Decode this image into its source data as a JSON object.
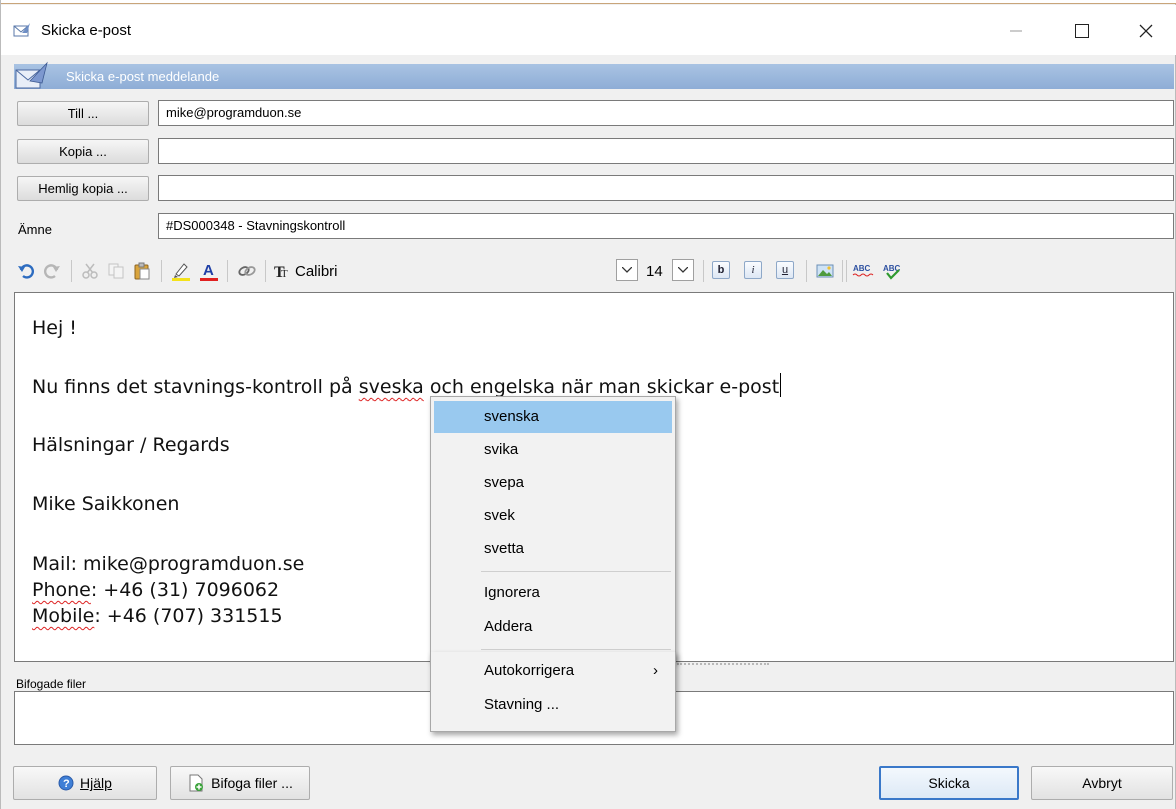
{
  "window": {
    "title": "Skicka e-post"
  },
  "banner": {
    "text": "Skicka e-post meddelande"
  },
  "address": {
    "to_button": "Till ...",
    "to_value": "mike@programduon.se",
    "cc_button": "Kopia ...",
    "cc_value": "",
    "bcc_button": "Hemlig kopia ...",
    "bcc_value": "",
    "subject_label": "Ämne",
    "subject_value": "#DS000348 - Stavningskontroll"
  },
  "toolbar": {
    "font_name": "Calibri",
    "font_size": "14",
    "bold": "b",
    "italic": "i",
    "underline": "u",
    "spell_check_label": "ABC",
    "spell_auto_label": "ABC"
  },
  "body": {
    "greeting": "Hej !",
    "line_pre": "Nu finns det stavnings-kontroll på ",
    "misspelled": "sveska",
    "line_post": " och engelska när man skickar e-post",
    "regards": "Hälsningar / Regards",
    "name": "Mike Saikkonen",
    "mail_label": "Mail: ",
    "mail_value": "mike@programduon.se",
    "phone_label": "Phone",
    "phone_value": ": +46 (31) 7096062",
    "mobile_label": "Mobile",
    "mobile_value": ": +46 (707) 331515"
  },
  "context_menu": {
    "suggestions": [
      "svenska",
      "svika",
      "svepa",
      "svek",
      "svetta"
    ],
    "ignore": "Ignorera",
    "add": "Addera",
    "autocorrect": "Autokorrigera",
    "spelling": "Stavning ..."
  },
  "attachments": {
    "label": "Bifogade filer"
  },
  "buttons": {
    "help": "Hjälp",
    "attach": "Bifoga filer ...",
    "send": "Skicka",
    "cancel": "Avbryt"
  }
}
